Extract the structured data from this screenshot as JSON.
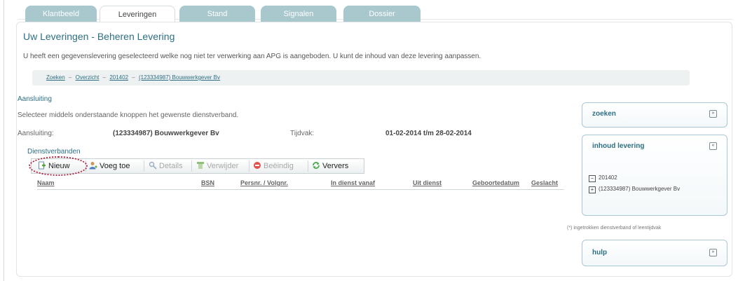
{
  "tabs": [
    {
      "label": "Klantbeeld",
      "active": false
    },
    {
      "label": "Leveringen",
      "active": true
    },
    {
      "label": "Stand",
      "active": false
    },
    {
      "label": "Signalen",
      "active": false
    },
    {
      "label": "Dossier",
      "active": false
    }
  ],
  "page": {
    "title": "Uw Leveringen - Beheren Levering",
    "intro": "U heeft een gegevenslevering geselecteerd welke nog niet ter verwerking aan APG is aangeboden. U kunt de inhoud van deze levering aanpassen."
  },
  "breadcrumb": [
    "Zoeken",
    "Overzicht",
    "201402",
    "(123334987) Bouwwerkgever Bv"
  ],
  "breadcrumb_sep": "–",
  "aansluiting": {
    "section_label": "Aansluiting",
    "instruction": "Selecteer middels onderstaande knoppen het gewenste dienstverband.",
    "label": "Aansluiting:",
    "value": "(123334987) Bouwwerkgever Bv",
    "tijdvak_label": "Tijdvak:",
    "tijdvak_value": "01-02-2014 t/m 28-02-2014"
  },
  "dienstverbanden": {
    "title": "Dienstverbanden",
    "toolbar": [
      {
        "label": "Nieuw",
        "icon": "new-document-icon",
        "enabled": true,
        "color": "#5aa23c"
      },
      {
        "label": "Voeg toe",
        "icon": "add-person-icon",
        "enabled": true,
        "color": "#4a7fbf"
      },
      {
        "label": "Details",
        "icon": "magnifier-icon",
        "enabled": false,
        "color": "#9ab0c8"
      },
      {
        "label": "Verwijder",
        "icon": "delete-icon",
        "enabled": false,
        "color": "#8fc07a"
      },
      {
        "label": "Beëindig",
        "icon": "stop-icon",
        "enabled": false,
        "color": "#e0524a"
      },
      {
        "label": "Ververs",
        "icon": "refresh-icon",
        "enabled": true,
        "color": "#48a84a"
      }
    ],
    "columns": [
      "Naam",
      "BSN",
      "Persnr. / Volgnr.",
      "In dienst vanaf",
      "Uit dienst",
      "Geboortedatum",
      "Geslacht"
    ]
  },
  "sidebar": {
    "zoeken": {
      "title": "zoeken",
      "toggle": "»"
    },
    "inhoud": {
      "title": "inhoud levering",
      "toggle": "«",
      "tree": [
        {
          "toggle": "−",
          "label": "201402"
        },
        {
          "toggle": "+",
          "label": "(123334987) Bouwwerkgever Bv"
        }
      ]
    },
    "footnote": "(*) ingetrokken dienstverband of leentijdvak",
    "hulp": {
      "title": "hulp",
      "toggle": "»"
    }
  },
  "colors": {
    "accent": "#2d6f83",
    "tab_inactive": "#a8c8cd",
    "highlight": "#b0203a"
  }
}
